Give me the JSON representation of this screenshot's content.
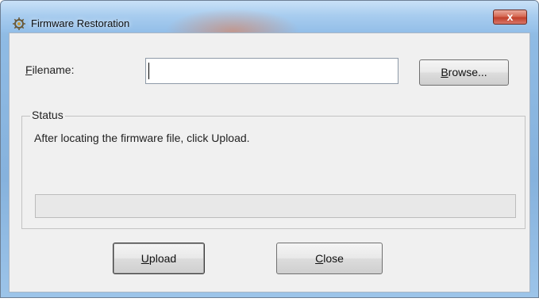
{
  "window": {
    "title": "Firmware Restoration",
    "close_glyph": "x",
    "app_icon": "firmware-tool-icon"
  },
  "form": {
    "filename_label_first": "F",
    "filename_label_rest": "ilename:",
    "filename_value": "",
    "browse_first": "B",
    "browse_rest": "rowse..."
  },
  "status": {
    "legend": "Status",
    "message": "After locating the firmware file, click Upload.",
    "progress": 0
  },
  "buttons": {
    "upload_first": "U",
    "upload_rest": "pload",
    "close_first": "C",
    "close_rest": "lose"
  },
  "colors": {
    "titlebar": "#a9cdef",
    "close_button": "#c1402b",
    "dialog_background": "#f0f0f0"
  }
}
